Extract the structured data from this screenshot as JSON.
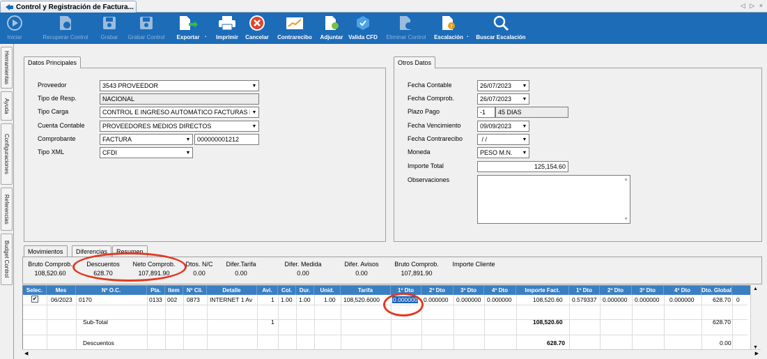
{
  "window": {
    "tab_title": "Control y Registración de Factura...",
    "tab_nav": "◁ ▷ ×"
  },
  "toolbar": {
    "iniciar": "Iniciar",
    "recuperar_control": "Recuperar Control",
    "grabar": "Grabar",
    "grabar_control": "Grabar Control",
    "exportar": "Exportar",
    "imprimir": "Imprimir",
    "cancelar": "Cancelar",
    "contrarecibo": "Contrarecibo",
    "adjuntar": "Adjuntar",
    "valida_cfd": "Valida CFD",
    "eliminar_control": "Eliminar Control",
    "escalacion": "Escalación",
    "buscar_escalacion": "Buscar Escalación"
  },
  "sidebar": {
    "tabs": [
      "Herramientas",
      "Ayuda",
      "Configuraciones",
      "Referencias",
      "Budget Control"
    ]
  },
  "datos_principales": {
    "tab_label": "Datos Principales",
    "proveedor_label": "Proveedor",
    "proveedor_value": "3543 PROVEEDOR",
    "tipo_resp_label": "Tipo de Resp.",
    "tipo_resp_value": "NACIONAL",
    "tipo_carga_label": "Tipo Carga",
    "tipo_carga_value": "CONTROL E INGRESO AUTOMÁTICO FACTURAS DE MED",
    "cuenta_contable_label": "Cuenta Contable",
    "cuenta_contable_value": "PROVEEDORES MEDIOS DIRECTOS",
    "comprobante_label": "Comprobante",
    "comprobante_value": "FACTURA",
    "comprobante_number": "000000001212",
    "tipo_xml_label": "Tipo XML",
    "tipo_xml_value": "CFDI"
  },
  "otros_datos": {
    "tab_label": "Otros Datos",
    "fecha_contable_label": "Fecha Contable",
    "fecha_contable_value": "26/07/2023",
    "fecha_comprob_label": "Fecha Comprob.",
    "fecha_comprob_value": "26/07/2023",
    "plazo_pago_label": "Plazo Pago",
    "plazo_pago_code": "-1",
    "plazo_pago_value": "45 DIAS",
    "fecha_vencimiento_label": "Fecha Vencimiento",
    "fecha_vencimiento_value": "09/09/2023",
    "fecha_contrarecibo_label": "Fecha Contrarecibo",
    "fecha_contrarecibo_value": " / /",
    "moneda_label": "Moneda",
    "moneda_value": "PESO M.N.",
    "importe_total_label": "Importe Total",
    "importe_total_value": "125,154.60",
    "observaciones_label": "Observaciones",
    "observaciones_value": ""
  },
  "lower_tabs": [
    "Movimientos",
    "Diferencias",
    "Resumen"
  ],
  "summary": {
    "labels": [
      "Bruto Comprob.",
      "Descuentos",
      "Neto Comprob.",
      "Dtos. N/C",
      "Difer.Tarifa",
      "Difer. Medida",
      "Difer. Avisos",
      "Bruto Comprob.",
      "Importe Cliente"
    ],
    "values": [
      "108,520.60",
      "628.70",
      "107,891.90",
      "0.00",
      "0.00",
      "0.00",
      "0.00",
      "107,891.90",
      ""
    ]
  },
  "grid": {
    "headers": [
      "Selec.",
      "Mes",
      "Nº O.C.",
      "Pta.",
      "Item",
      "Nº Cli.",
      "Detalle",
      "Avi.",
      "Col.",
      "Dur.",
      "Unid.",
      "Tarifa",
      "1º Dto",
      "2º Dto",
      "3º Dto",
      "4º Dto",
      "Importe Fact.",
      "1º Dto",
      "2º Dto",
      "3º Dto",
      "4º Dto",
      "Dto. Global"
    ],
    "row": [
      "",
      "06/2023",
      "0170",
      "0133",
      "002",
      "0873",
      "INTERNET 1 Av",
      "1",
      "1.00",
      "1.00",
      "1.00",
      "108,520.6000",
      "0.000000",
      "0.000000",
      "0.000000",
      "0.000000",
      "108,520.60",
      "0.579337",
      "0.000000",
      "0.000000",
      "0.000000",
      "628.70",
      "0"
    ],
    "subtotal_label": "Sub-Total",
    "subtotal_avi": "1",
    "subtotal_importe": "108,520.60",
    "subtotal_global": "628.70",
    "descuentos_label": "Descuentos",
    "descuentos_importe": "628.70",
    "descuentos_global": "0.00"
  },
  "colors": {
    "ribbon": "#1c6cb8",
    "grid_header": "#3a7fc2",
    "highlight": "#e03a20"
  }
}
